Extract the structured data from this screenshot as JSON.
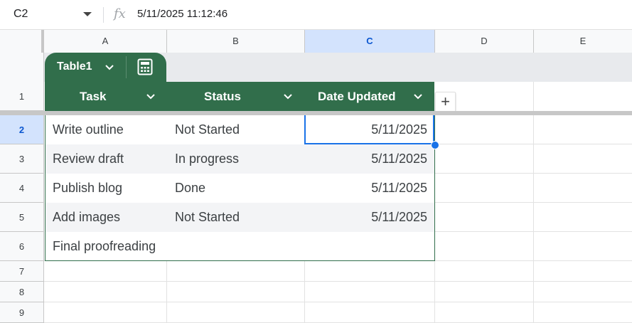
{
  "formula_bar": {
    "name_box": "C2",
    "fx_label": "fx",
    "content": "5/11/2025 11:12:46"
  },
  "columns": [
    "A",
    "B",
    "C",
    "D",
    "E"
  ],
  "selected_column": "C",
  "rows": [
    "1",
    "2",
    "3",
    "4",
    "5",
    "6",
    "7",
    "8",
    "9"
  ],
  "selected_row": "2",
  "table": {
    "name": "Table1",
    "header_color": "#316e4b",
    "headers": [
      "Task",
      "Status",
      "Date Updated"
    ],
    "data": [
      {
        "task": "Write outline",
        "status": "Not Started",
        "date": "5/11/2025"
      },
      {
        "task": "Review draft",
        "status": "In progress",
        "date": "5/11/2025"
      },
      {
        "task": "Publish blog",
        "status": "Done",
        "date": "5/11/2025"
      },
      {
        "task": "Add images",
        "status": "Not Started",
        "date": "5/11/2025"
      },
      {
        "task": "Final proofreading",
        "status": "",
        "date": ""
      }
    ]
  },
  "add_column_label": "+",
  "selection_color": "#1a73e8"
}
